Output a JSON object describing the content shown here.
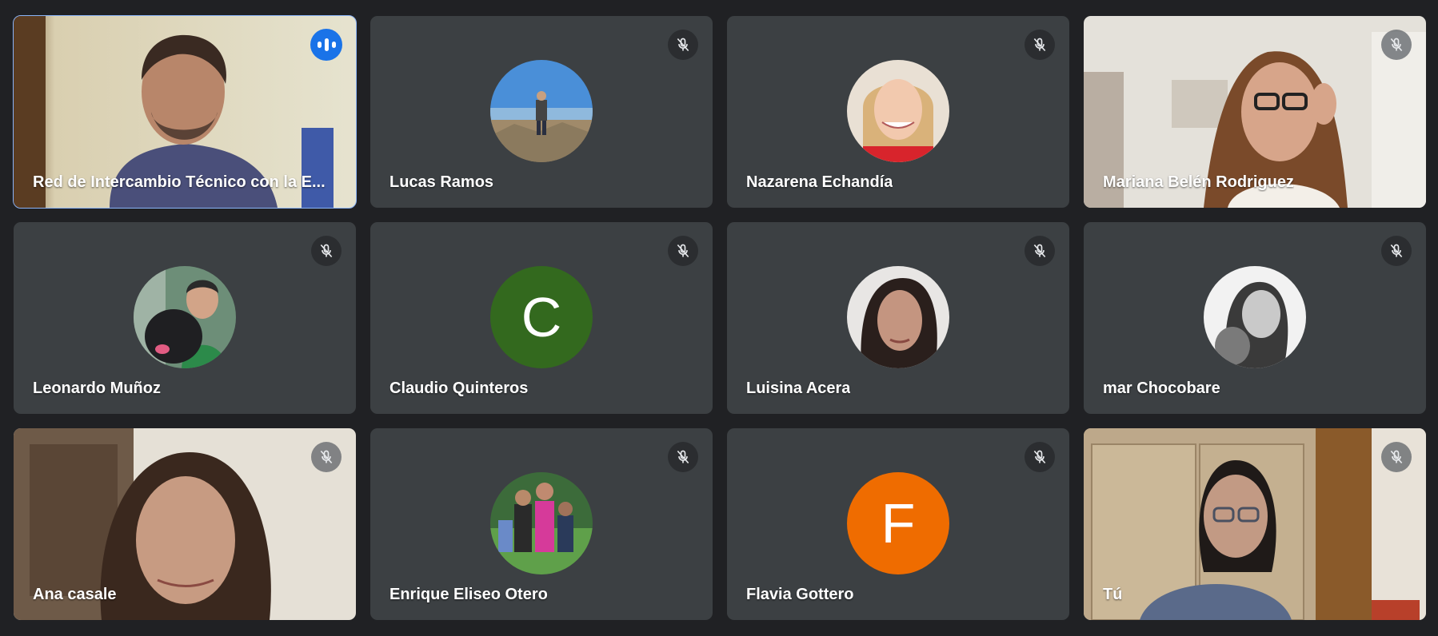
{
  "participants": [
    {
      "name": "Red de Intercambio Técnico con la E...",
      "speaking": true
    },
    {
      "name": "Lucas Ramos",
      "muted": true
    },
    {
      "name": "Nazarena Echandía",
      "muted": true
    },
    {
      "name": "Mariana Belén Rodriguez",
      "muted": true
    },
    {
      "name": "Leonardo Muñoz",
      "muted": true
    },
    {
      "name": "Claudio Quinteros",
      "muted": true,
      "initial": "C",
      "avatar_color": "#33691e"
    },
    {
      "name": "Luisina Acera",
      "muted": true
    },
    {
      "name": "mar Chocobare",
      "muted": true
    },
    {
      "name": "Ana casale",
      "muted": true
    },
    {
      "name": "Enrique Eliseo Otero",
      "muted": true
    },
    {
      "name": "Flavia Gottero",
      "muted": true,
      "initial": "F",
      "avatar_color": "#ef6c00"
    },
    {
      "name": "Tú",
      "muted": true
    }
  ],
  "colors": {
    "background": "#202124",
    "tile": "#3c4043",
    "speaking_outline": "#8ab4f8",
    "speaking_indicator": "#1a73e8"
  }
}
